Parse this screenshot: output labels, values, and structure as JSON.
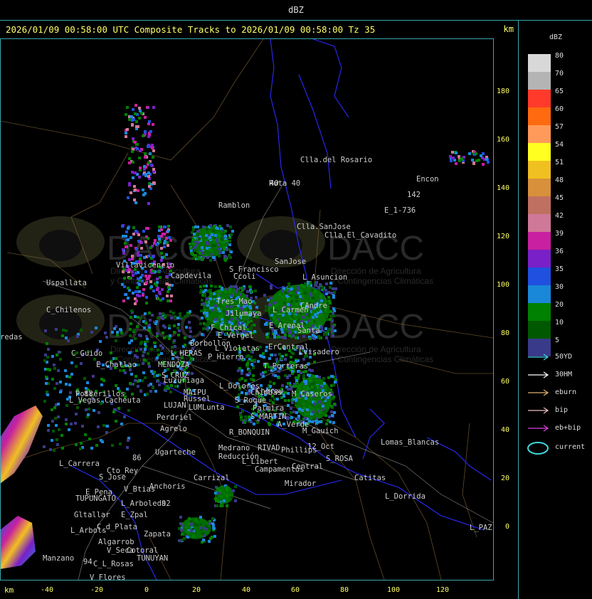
{
  "window": {
    "title": "dBZ"
  },
  "header": {
    "title": "2026/01/09 00:58:00 UTC Composite Tracks to 2026/01/09 00:58:00 Tz 35",
    "unit": "km"
  },
  "axes": {
    "x_unit": "km",
    "x_ticks": [
      "-40",
      "-20",
      "0",
      "20",
      "40",
      "60",
      "80",
      "100",
      "120"
    ],
    "y_ticks": [
      "180",
      "160",
      "140",
      "120",
      "100",
      "80",
      "60",
      "40",
      "20",
      "0"
    ]
  },
  "watermark": {
    "text": "DACC",
    "sub1": "Dirección de Agricultura",
    "sub2": "y Contingencias Climáticas"
  },
  "legend": {
    "title": "dBZ",
    "levels": [
      {
        "label": "80",
        "color": "#d8d8d8"
      },
      {
        "label": "70",
        "color": "#b4b4b4"
      },
      {
        "label": "65",
        "color": "#ff3a2a"
      },
      {
        "label": "60",
        "color": "#ff6a10"
      },
      {
        "label": "57",
        "color": "#ff9a5a"
      },
      {
        "label": "54",
        "color": "#ffff20"
      },
      {
        "label": "51",
        "color": "#f0c020"
      },
      {
        "label": "48",
        "color": "#d8903a"
      },
      {
        "label": "45",
        "color": "#c07060"
      },
      {
        "label": "42",
        "color": "#d07898"
      },
      {
        "label": "39",
        "color": "#c820a0"
      },
      {
        "label": "36",
        "color": "#7a20c8"
      },
      {
        "label": "35",
        "color": "#2050e0"
      },
      {
        "label": "30",
        "color": "#1a88d8"
      },
      {
        "label": "20",
        "color": "#008000"
      },
      {
        "label": "10",
        "color": "#005800"
      },
      {
        "label": "5",
        "color": "#3a3a8a"
      }
    ],
    "tracks": [
      {
        "label": "50YD",
        "color": "#40d8e0"
      },
      {
        "label": "30HM",
        "color": "#ffffff"
      },
      {
        "label": "eburn",
        "color": "#e0b070"
      },
      {
        "label": "bip",
        "color": "#f0c0c0"
      },
      {
        "label": "eb+bip",
        "color": "#e040e0"
      }
    ],
    "current_label": "current",
    "current_color": "#40d8e0"
  },
  "cities": [
    {
      "name": "Clla.del Rosario"
    },
    {
      "name": "Encon"
    },
    {
      "name": "142"
    },
    {
      "name": "E_1-736"
    },
    {
      "name": "Ramblon"
    },
    {
      "name": "Clla.SanJose"
    },
    {
      "name": "Clla.El_Cavadito"
    },
    {
      "name": "Uspallata"
    },
    {
      "name": "Villavicencio"
    },
    {
      "name": "Capdevila"
    },
    {
      "name": "S_Francisco"
    },
    {
      "name": "SanJose"
    },
    {
      "name": "L_Asuncion"
    },
    {
      "name": "Ccoli"
    },
    {
      "name": "C_Chilenos"
    },
    {
      "name": "Tres_Mao"
    },
    {
      "name": "Jilumaya"
    },
    {
      "name": "L_Carmen"
    },
    {
      "name": "CAndre"
    },
    {
      "name": "redas"
    },
    {
      "name": "F_Chical"
    },
    {
      "name": "E_Vergel"
    },
    {
      "name": "E_Arenal"
    },
    {
      "name": "Santa"
    },
    {
      "name": "Borbollon"
    },
    {
      "name": "L_Violetas"
    },
    {
      "name": "ErCentral"
    },
    {
      "name": "C_Guido"
    },
    {
      "name": "L_HERAS"
    },
    {
      "name": "P_Hierro"
    },
    {
      "name": "Lvisadero"
    },
    {
      "name": "E_Challao"
    },
    {
      "name": "MENDOZA"
    },
    {
      "name": "T_Porteras"
    },
    {
      "name": "S_CRUZ"
    },
    {
      "name": "Luzuriaga"
    },
    {
      "name": "L_Dolores"
    },
    {
      "name": "Cheraw"
    },
    {
      "name": "Potrerillos"
    },
    {
      "name": "MAIPU"
    },
    {
      "name": "Chimbas"
    },
    {
      "name": "M_Caseros"
    },
    {
      "name": "L_Vegas"
    },
    {
      "name": "Cacheuta"
    },
    {
      "name": "Russel"
    },
    {
      "name": "S_Roque"
    },
    {
      "name": "LUJAN"
    },
    {
      "name": "LUMLunta"
    },
    {
      "name": "Palmira"
    },
    {
      "name": "Perdriel"
    },
    {
      "name": "S_MARTIN"
    },
    {
      "name": "A_Verde"
    },
    {
      "name": "Agrelo"
    },
    {
      "name": "R_BONQUIN"
    },
    {
      "name": "M_Gauich"
    },
    {
      "name": "Lomas_Blancas"
    },
    {
      "name": "Ugarteche"
    },
    {
      "name": "Medrano"
    },
    {
      "name": "RIVAD"
    },
    {
      "name": "Phillips"
    },
    {
      "name": "12_Oct"
    },
    {
      "name": "Reducción"
    },
    {
      "name": "L_Libert"
    },
    {
      "name": "S_ROSA"
    },
    {
      "name": "L_Carrera"
    },
    {
      "name": "Cto_Rey"
    },
    {
      "name": "Campamentos"
    },
    {
      "name": "Central"
    },
    {
      "name": "S_Jose"
    },
    {
      "name": "Carrizal"
    },
    {
      "name": "Catitas"
    },
    {
      "name": "V_Btias"
    },
    {
      "name": "Anchoris"
    },
    {
      "name": "Mirador"
    },
    {
      "name": "E_Pena"
    },
    {
      "name": "TUPUNGATO"
    },
    {
      "name": "L_Dorrida"
    },
    {
      "name": "L_Arboleda"
    },
    {
      "name": "Gltallar"
    },
    {
      "name": "E_Zpal"
    },
    {
      "name": "C_d_Plata"
    },
    {
      "name": "L_Arbols"
    },
    {
      "name": "Zapata"
    },
    {
      "name": "L_PAZ"
    },
    {
      "name": "Algarrob"
    },
    {
      "name": "V_Seca"
    },
    {
      "name": "Cotoral"
    },
    {
      "name": "TUNUYAN"
    },
    {
      "name": "Manzano"
    },
    {
      "name": "C_L_Rosas"
    },
    {
      "name": "V_Flores"
    },
    {
      "name": "Ruta 40"
    },
    {
      "name": "88"
    },
    {
      "name": "86"
    },
    {
      "name": "92"
    },
    {
      "name": "94"
    },
    {
      "name": "40"
    }
  ]
}
